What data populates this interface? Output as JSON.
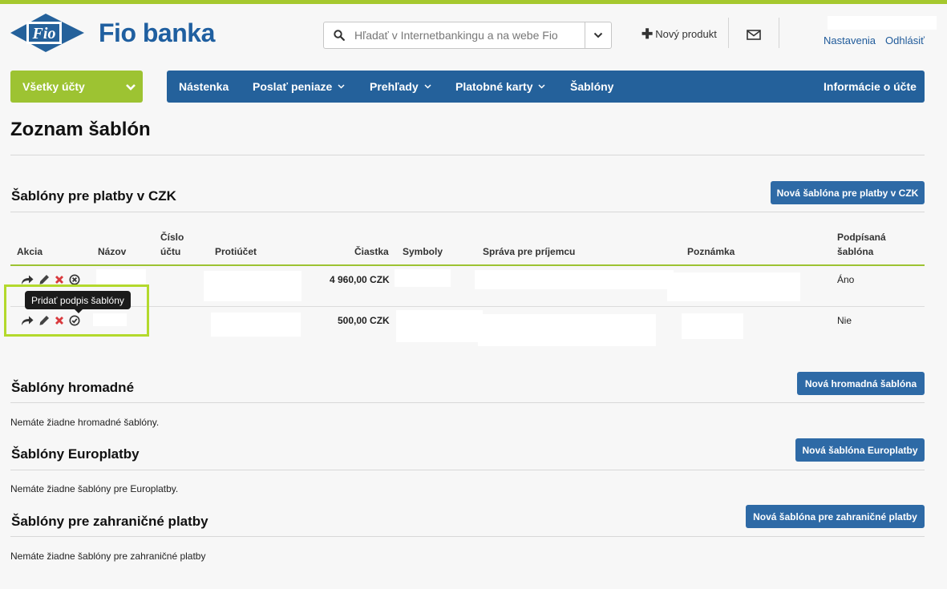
{
  "header": {
    "brand": "Fio banka",
    "logo_text": "Fio",
    "search_placeholder": "Hľadať v Internetbankingu a na webe Fio",
    "new_product": "Nový produkt",
    "settings": "Nastavenia",
    "logout": "Odhlásiť"
  },
  "nav": {
    "accounts": "Všetky účty",
    "items": [
      "Nástenka",
      "Poslať peniaze",
      "Prehľady",
      "Platobné karty",
      "Šablóny"
    ],
    "account_info": "Informácie o účte"
  },
  "page_title": "Zoznam šablón",
  "czk": {
    "title": "Šablóny pre platby v CZK",
    "button": "Nová šablóna pre platby v CZK",
    "columns": {
      "action": "Akcia",
      "name": "Názov",
      "account_1": "Číslo",
      "account_2": "účtu",
      "counter": "Protiúčet",
      "amount": "Čiastka",
      "symbols": "Symboly",
      "message": "Správa pre príjemcu",
      "note": "Poznámka",
      "signed_1": "Podpísaná",
      "signed_2": "šablóna"
    },
    "rows": [
      {
        "amount": "4 960,00 CZK",
        "signed": "Áno"
      },
      {
        "amount": "500,00 CZK",
        "signed": "Nie"
      }
    ],
    "tooltip": "Pridať podpis šablóny"
  },
  "bulk": {
    "title": "Šablóny hromadné",
    "button": "Nová hromadná šablóna",
    "empty": "Nemáte žiadne hromadné šablóny."
  },
  "euro": {
    "title": "Šablóny Europlatby",
    "button": "Nová šablóna Europlatby",
    "empty": "Nemáte žiadne šablóny pre Europlatby."
  },
  "foreign": {
    "title": "Šablóny pre zahraničné platby",
    "button": "Nová šablóna pre zahraničné platby",
    "empty": "Nemáte žiadne šablóny pre zahraničné platby"
  },
  "colors": {
    "brand_blue": "#24619b",
    "brand_green": "#9dc332",
    "button_blue": "#2e6aa6"
  }
}
